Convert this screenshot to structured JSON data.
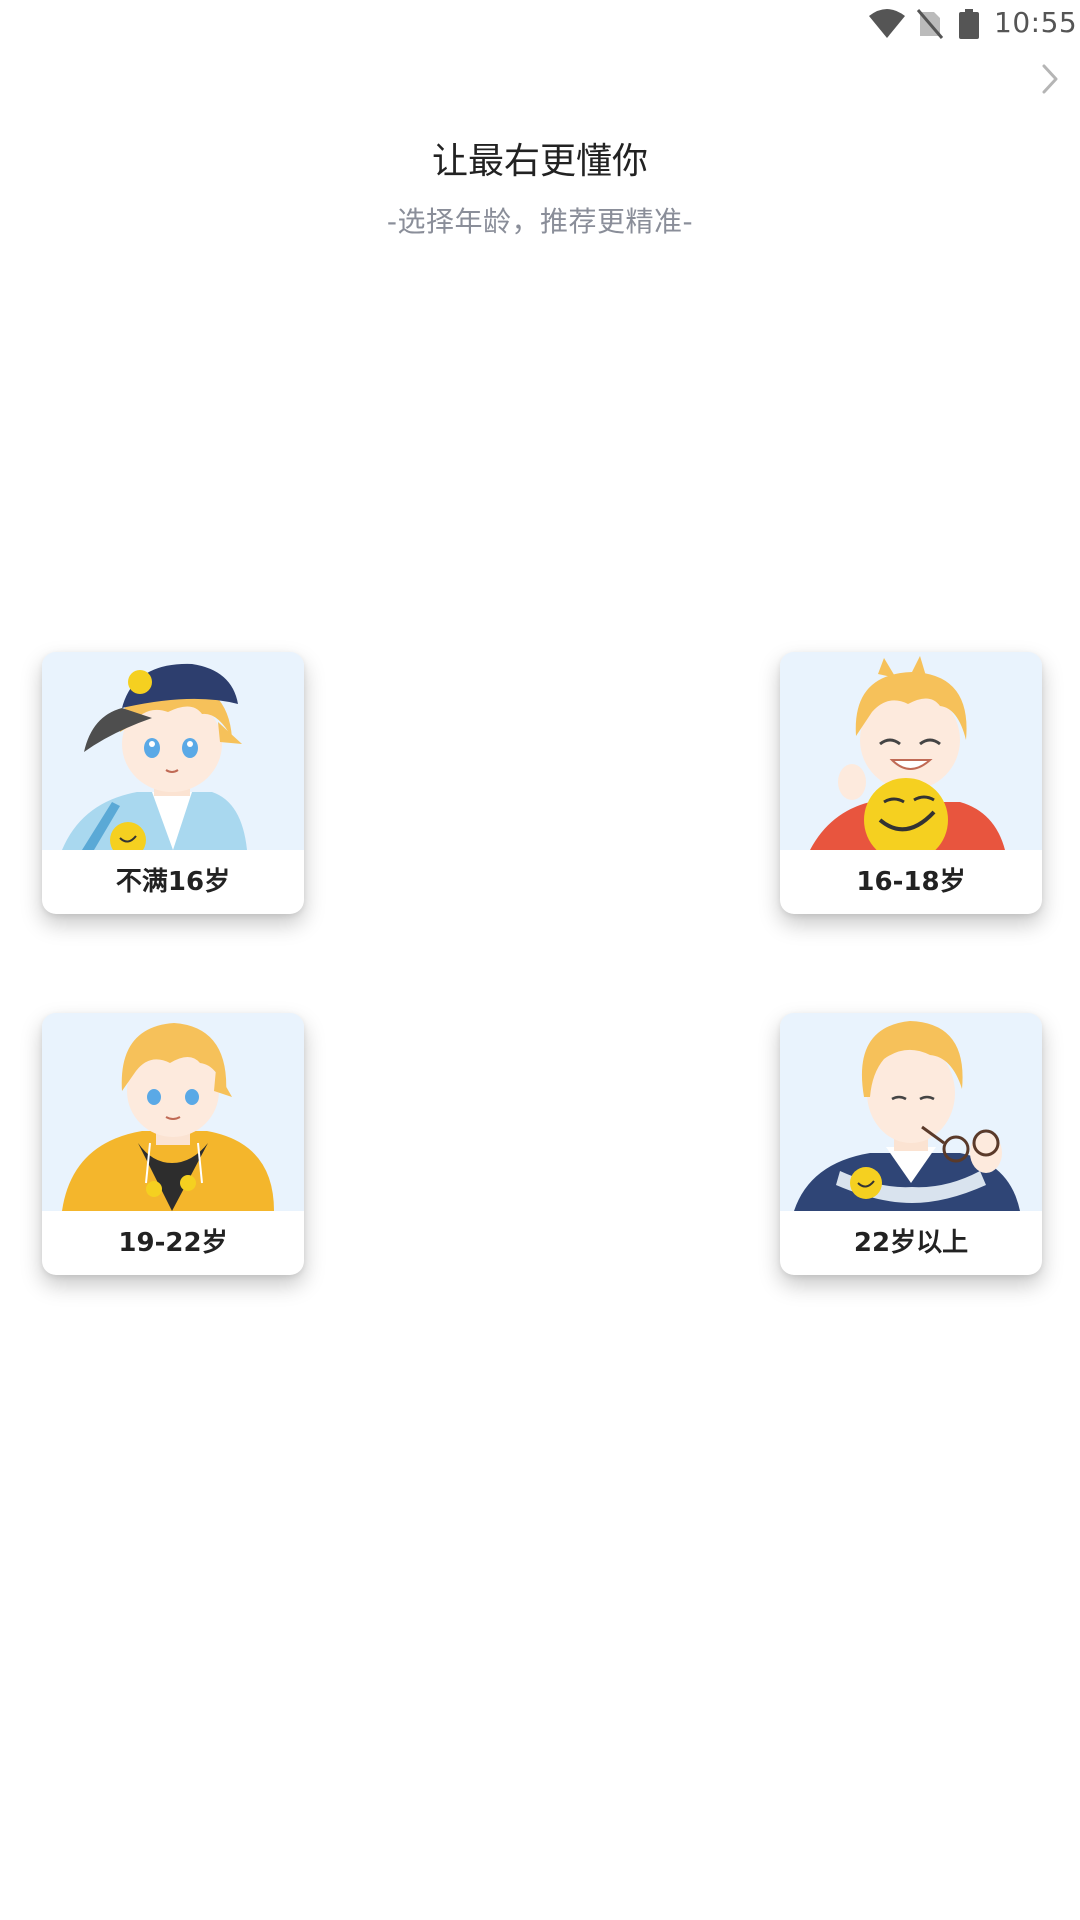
{
  "status_bar": {
    "time": "10:55",
    "icons": [
      "wifi-icon",
      "no-sim-icon",
      "battery-icon"
    ]
  },
  "header": {
    "skip_icon": "chevron-right-icon",
    "title": "让最右更懂你",
    "subtitle": "-选择年龄，推荐更精准-"
  },
  "age_options": [
    {
      "label": "不满16岁",
      "illustration": "boy-with-cap-avatar"
    },
    {
      "label": "16-18岁",
      "illustration": "smiling-boy-with-emoji-avatar"
    },
    {
      "label": "19-22岁",
      "illustration": "boy-in-yellow-hoodie-avatar"
    },
    {
      "label": "22岁以上",
      "illustration": "man-with-glasses-avatar"
    }
  ],
  "colors": {
    "illustration_bg": "#e9f3fd",
    "hair": "#f6c15a",
    "subtitle": "#8a8e99",
    "emoji_yellow": "#f5d020"
  }
}
